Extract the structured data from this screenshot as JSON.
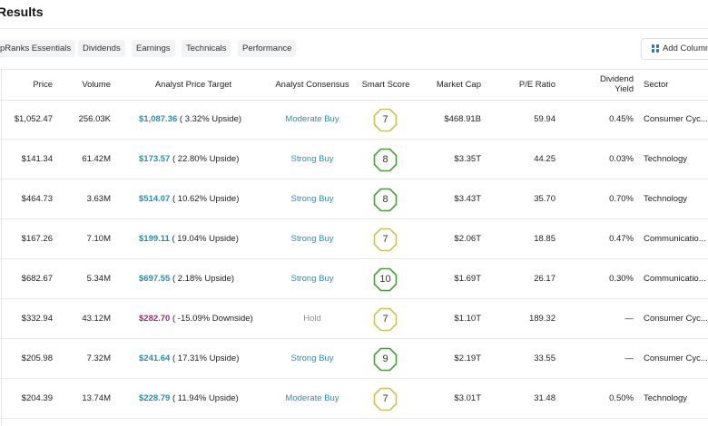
{
  "page": {
    "title": "Results"
  },
  "tabs": [
    "pRanks Essentials",
    "Dividends",
    "Earnings",
    "Technicals",
    "Performance"
  ],
  "add_columns_label": "Add Column",
  "columns": {
    "price": "Price",
    "volume": "Volume",
    "target": "Analyst Price Target",
    "consensus": "Analyst Consensus",
    "score": "Smart Score",
    "cap": "Market Cap",
    "pe": "P/E Ratio",
    "div_line1": "Dividend",
    "div_line2": "Yield",
    "sector": "Sector"
  },
  "colors": {
    "upside_target": "#2a8fa7",
    "downside_target": "#9c2b73",
    "score_green": "#4f9a3c",
    "score_yellow": "#c9c25a"
  },
  "rows": [
    {
      "price": "$1,052.47",
      "volume": "256.03K",
      "target": "$1,087.36",
      "upside": "( 3.32% Upside)",
      "direction": "up",
      "consensus": "Moderate Buy",
      "score": "7",
      "score_color": "yellow",
      "cap": "$468.91B",
      "pe": "59.94",
      "div": "0.45%",
      "sector": "Consumer Cyc..."
    },
    {
      "price": "$141.34",
      "volume": "61.42M",
      "target": "$173.57",
      "upside": "( 22.80% Upside)",
      "direction": "up",
      "consensus": "Strong Buy",
      "score": "8",
      "score_color": "green",
      "cap": "$3.35T",
      "pe": "44.25",
      "div": "0.03%",
      "sector": "Technology"
    },
    {
      "price": "$464.73",
      "volume": "3.63M",
      "target": "$514.07",
      "upside": "( 10.62% Upside)",
      "direction": "up",
      "consensus": "Strong Buy",
      "score": "8",
      "score_color": "green",
      "cap": "$3.43T",
      "pe": "35.70",
      "div": "0.70%",
      "sector": "Technology"
    },
    {
      "price": "$167.26",
      "volume": "7.10M",
      "target": "$199.11",
      "upside": "( 19.04% Upside)",
      "direction": "up",
      "consensus": "Strong Buy",
      "score": "7",
      "score_color": "yellow",
      "cap": "$2.06T",
      "pe": "18.85",
      "div": "0.47%",
      "sector": "Communicatio..."
    },
    {
      "price": "$682.67",
      "volume": "5.34M",
      "target": "$697.55",
      "upside": "( 2.18% Upside)",
      "direction": "up",
      "consensus": "Strong Buy",
      "score": "10",
      "score_color": "green",
      "cap": "$1.69T",
      "pe": "26.17",
      "div": "0.30%",
      "sector": "Communicatio..."
    },
    {
      "price": "$332.94",
      "volume": "43.12M",
      "target": "$282.70",
      "upside": "( -15.09% Downside)",
      "direction": "down",
      "consensus": "Hold",
      "score": "7",
      "score_color": "yellow",
      "cap": "$1.10T",
      "pe": "189.32",
      "div": "—",
      "sector": "Consumer Cyc..."
    },
    {
      "price": "$205.98",
      "volume": "7.32M",
      "target": "$241.64",
      "upside": "( 17.31% Upside)",
      "direction": "up",
      "consensus": "Strong Buy",
      "score": "9",
      "score_color": "green",
      "cap": "$2.19T",
      "pe": "33.55",
      "div": "—",
      "sector": "Consumer Cyc..."
    },
    {
      "price": "$204.39",
      "volume": "13.74M",
      "target": "$228.79",
      "upside": "( 11.94% Upside)",
      "direction": "up",
      "consensus": "Moderate Buy",
      "score": "7",
      "score_color": "yellow",
      "cap": "$3.01T",
      "pe": "31.48",
      "div": "0.50%",
      "sector": "Technology"
    }
  ]
}
